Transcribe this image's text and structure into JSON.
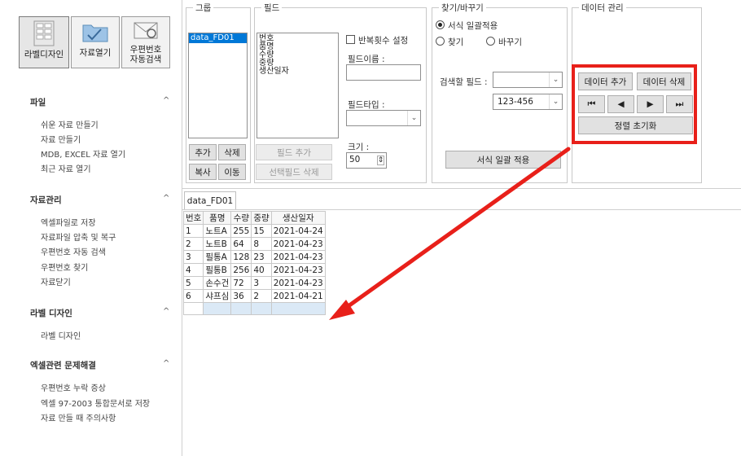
{
  "toolbar": {
    "label_design": "라벨디자인",
    "data_open": "자료열기",
    "postal_line1": "우편번호",
    "postal_line2": "자동검색"
  },
  "sidebar": {
    "sections": [
      {
        "title": "파일",
        "items": [
          "쉬운 자료 만들기",
          "자료 만들기",
          "MDB, EXCEL 자료 열기",
          "최근 자료 열기"
        ]
      },
      {
        "title": "자료관리",
        "items": [
          "엑셀파일로 저장",
          "자료파일 압축 및 복구",
          "우편번호 자동 검색",
          "우편번호 찾기",
          "자료닫기"
        ]
      },
      {
        "title": "라벨 디자인",
        "items": [
          "라벨 디자인"
        ]
      },
      {
        "title": "엑셀관련 문제해결",
        "items": [
          "우편번호 누락 증상",
          "엑셀 97-2003 통합문서로 저장",
          "자료 만들 때 주의사항"
        ]
      }
    ],
    "chevron": "^"
  },
  "group": {
    "legend": "그룹",
    "items": [
      "data_FD01"
    ],
    "add": "추가",
    "delete": "삭제",
    "copy": "복사",
    "move": "이동"
  },
  "field": {
    "legend": "필드",
    "items": [
      "번호",
      "품명",
      "수량",
      "중량",
      "생산일자"
    ],
    "repeat_label": "반복횟수 설정",
    "name_label": "필드이름 :",
    "type_label": "필드타입 :",
    "size_label": "크기 :",
    "size_value": "50",
    "add_field": "필드 추가",
    "delete_selected": "선택필드 삭제"
  },
  "find_replace": {
    "legend": "찾기/바꾸기",
    "bulk_apply": "서식 일괄적용",
    "find": "찾기",
    "replace": "바꾸기",
    "search_field_label": "검색할 필드 :",
    "format_value": "123-456",
    "apply_button": "서식 일괄 적용"
  },
  "data_mgmt": {
    "legend": "데이터 관리",
    "add": "데이터 추가",
    "delete": "데이터 삭제",
    "first": "⏮",
    "prev": "◀",
    "next": "▶",
    "last": "⏭",
    "reset_sort": "정렬 초기화"
  },
  "tab": {
    "name": "data_FD01"
  },
  "table": {
    "headers": [
      "번호",
      "품명",
      "수량",
      "중량",
      "생산일자"
    ],
    "rows": [
      [
        "1",
        "노트A",
        "255",
        "15",
        "2021-04-24"
      ],
      [
        "2",
        "노트B",
        "64",
        "8",
        "2021-04-23"
      ],
      [
        "3",
        "필통A",
        "128",
        "23",
        "2021-04-23"
      ],
      [
        "4",
        "필통B",
        "256",
        "40",
        "2021-04-23"
      ],
      [
        "5",
        "손수건",
        "72",
        "3",
        "2021-04-23"
      ],
      [
        "6",
        "샤프심",
        "36",
        "2",
        "2021-04-21"
      ]
    ]
  },
  "colors": {
    "highlight": "#e8201a",
    "arrow": "#e8201a"
  }
}
